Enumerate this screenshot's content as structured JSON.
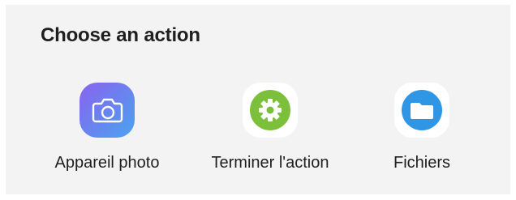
{
  "dialog": {
    "title": "Choose an action",
    "apps": [
      {
        "label": "Appareil photo",
        "icon": "camera-icon"
      },
      {
        "label": "Terminer l'action",
        "icon": "gear-icon"
      },
      {
        "label": "Fichiers",
        "icon": "folder-icon"
      }
    ]
  },
  "colors": {
    "sheet_background": "#f3f3f3",
    "camera_gradient_start": "#7b6cf0",
    "camera_gradient_end": "#4a9df0",
    "gear_green": "#7cbf3a",
    "folder_blue": "#2f95e5",
    "tile_white": "#ffffff"
  }
}
